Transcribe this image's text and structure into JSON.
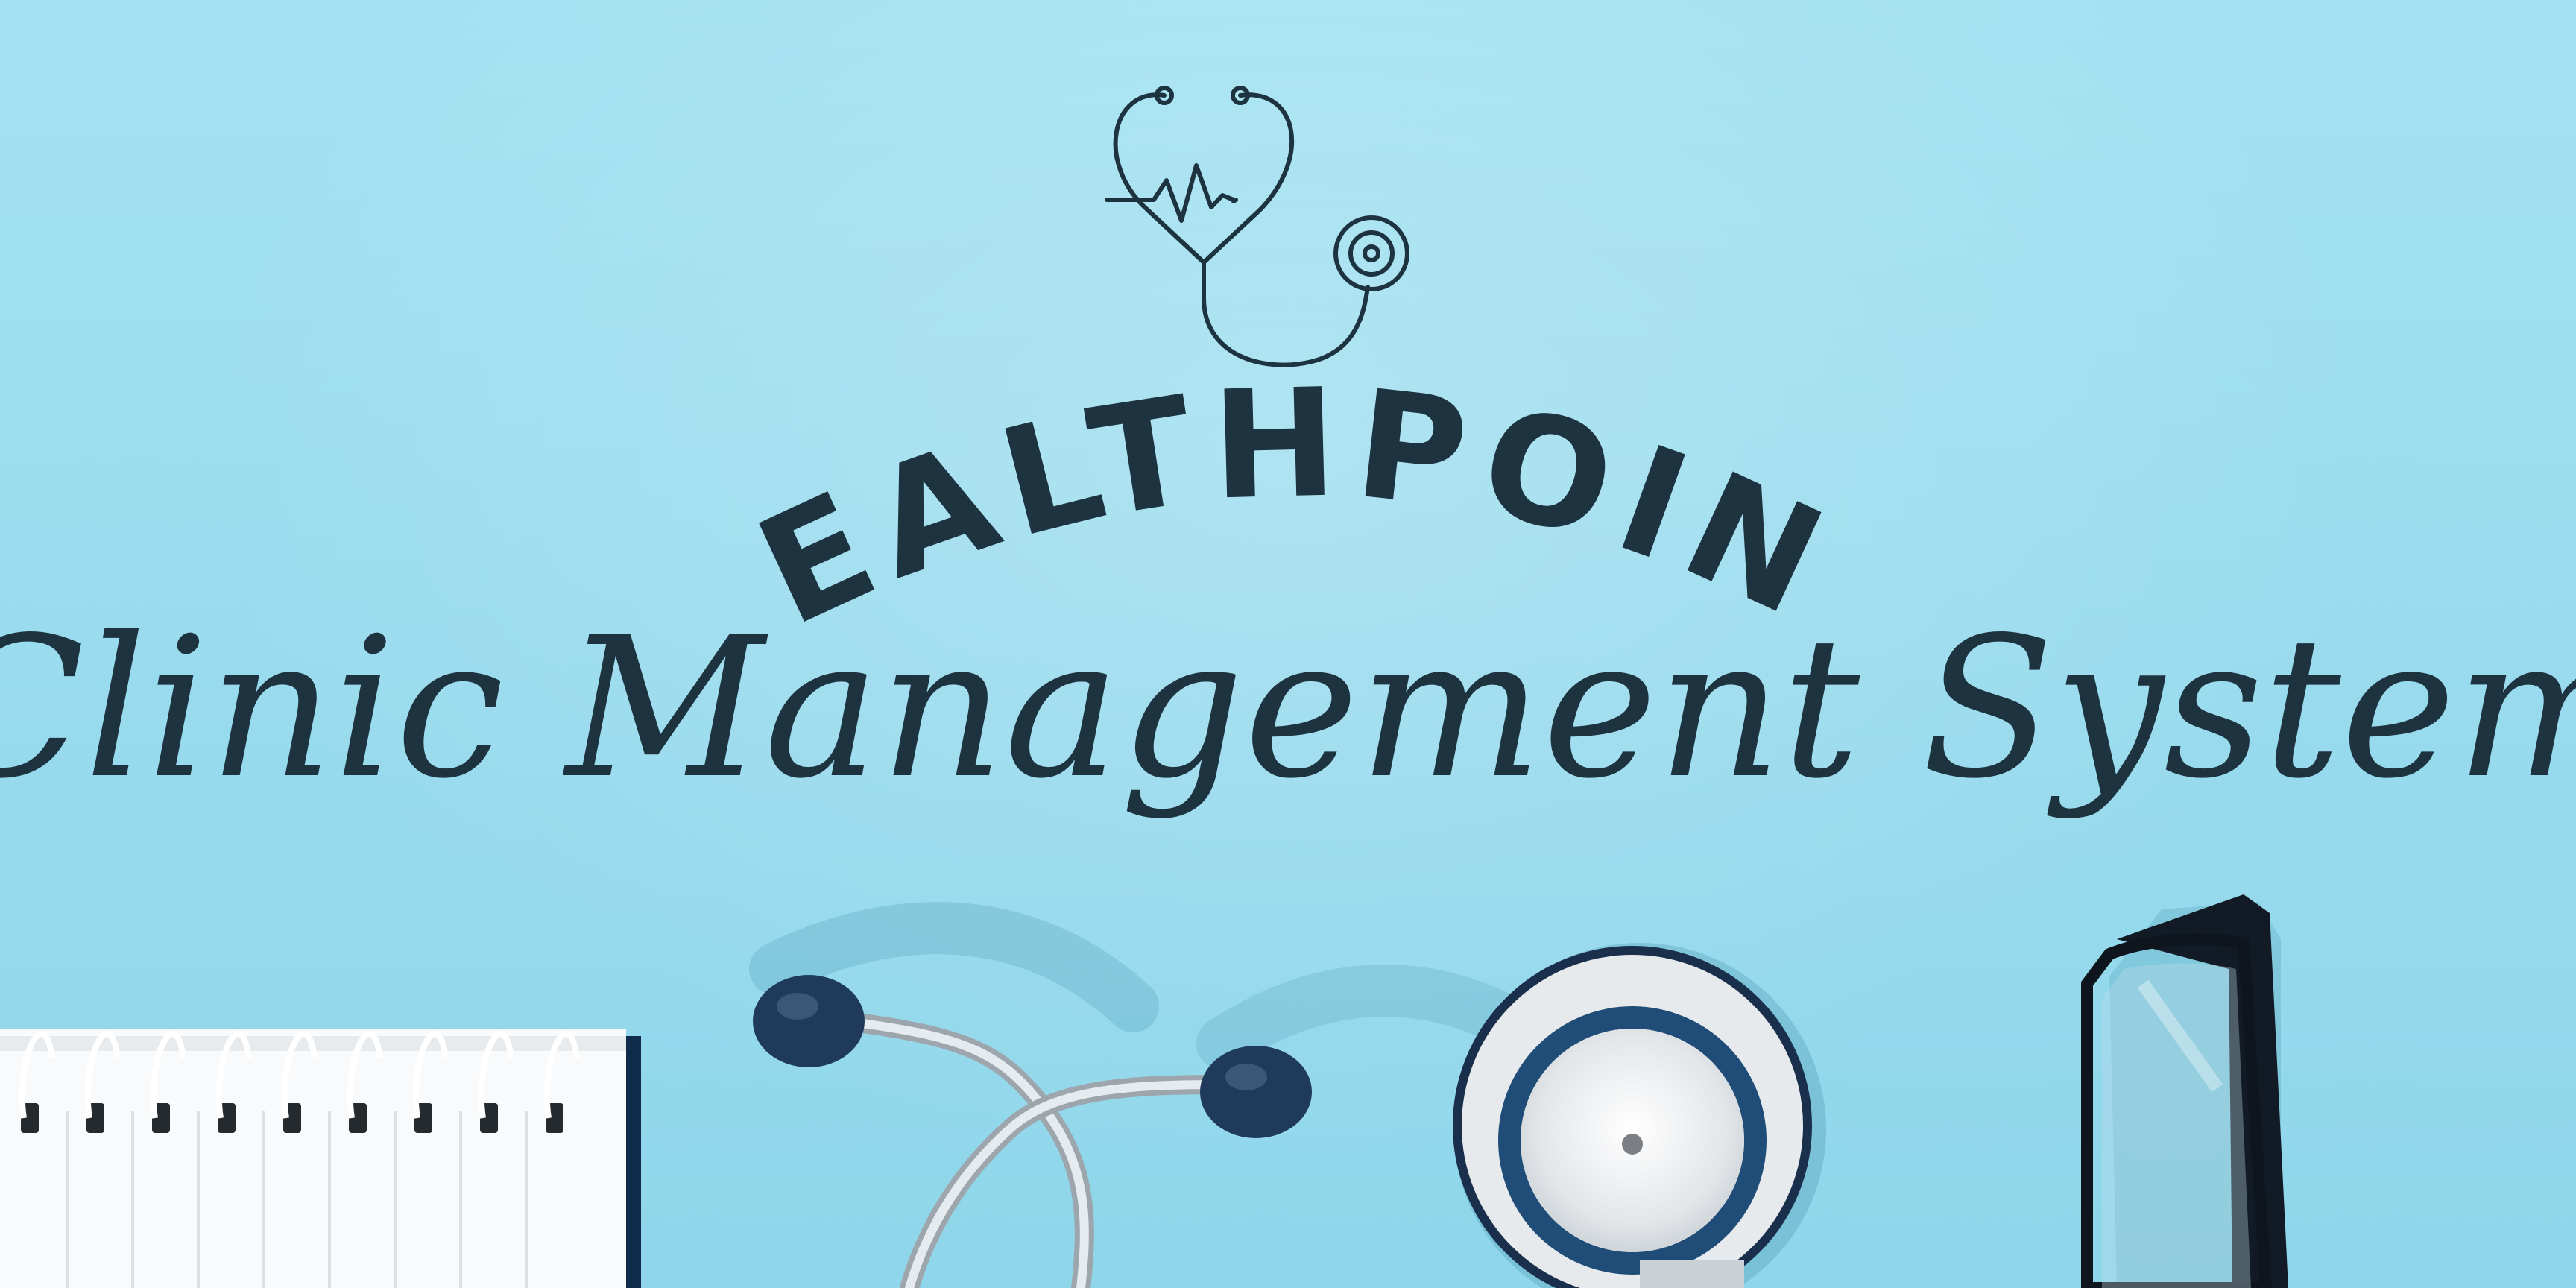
{
  "brand": {
    "title": "HEALTHPOINT",
    "subtitle": "Clinic Management System",
    "logo_icon": "stethoscope-heartbeat-icon",
    "ink_color": "#1e3340"
  },
  "background": {
    "color": "#9bdcee"
  },
  "scene_items": [
    "notebook",
    "stethoscope",
    "eyeglasses"
  ]
}
